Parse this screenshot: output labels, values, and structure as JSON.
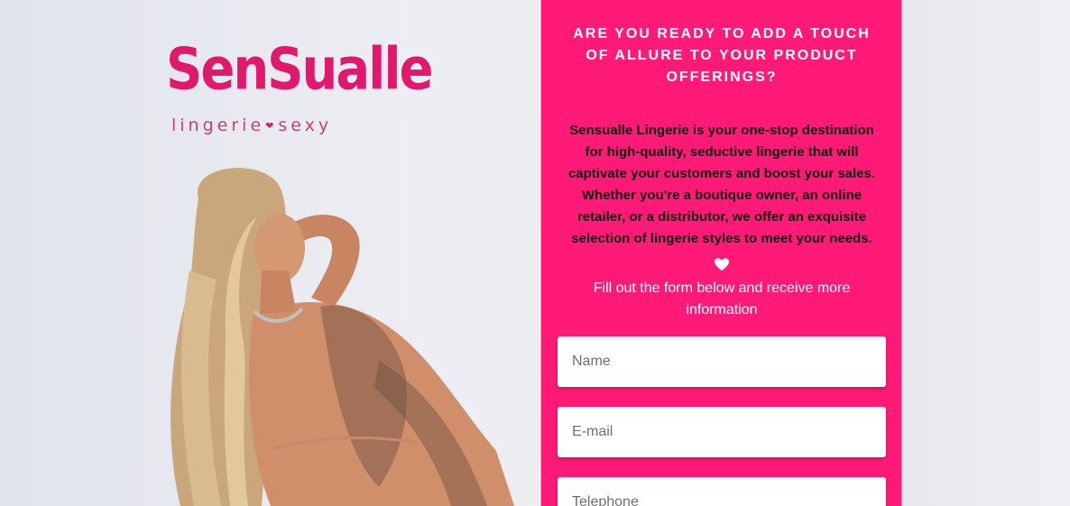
{
  "brand": {
    "logo_word": "SenSualle",
    "logo_sub_left": "lingerie",
    "logo_sub_right": "sexy",
    "logo_heart_icon": "heart-icon",
    "color": "#e2186c"
  },
  "panel": {
    "background": "#ff1a78",
    "headline": "ARE YOU READY TO ADD A TOUCH OF ALLURE TO YOUR PRODUCT OFFERINGS?",
    "description": "Sensualle Lingerie is your one-stop destination for high-quality, seductive lingerie that will captivate your customers and boost your sales. Whether you're a boutique owner, an online retailer, or a distributor, we offer an exquisite selection of lingerie styles to meet your needs.",
    "divider_icon": "heart-icon",
    "subtext": "Fill out the form below and receive more information"
  },
  "form": {
    "name_placeholder": "Name",
    "email_placeholder": "E-mail",
    "telephone_placeholder": "Telephone"
  }
}
